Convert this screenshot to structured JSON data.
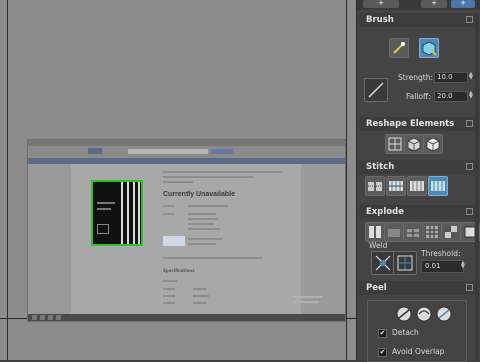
{
  "panel": {
    "brush": {
      "title": "Brush",
      "strength_label": "Strength:",
      "strength_value": "10.0",
      "falloff_label": "Falloff:",
      "falloff_value": "20.0"
    },
    "reshape": {
      "title": "Reshape Elements"
    },
    "stitch": {
      "title": "Stitch"
    },
    "explode": {
      "title": "Explode",
      "weld_label": "Weld",
      "threshold_label": "Threshold:",
      "threshold_value": "0.01"
    },
    "peel": {
      "title": "Peel",
      "detach_label": "Detach",
      "detach_checked": true,
      "avoid_overlap_label": "Avoid Overlap",
      "avoid_overlap_checked": true
    },
    "top_buttons": [
      "+",
      "+",
      "+"
    ]
  },
  "viewport": {
    "page_heading": "Currently Unavailable",
    "specs_heading": "Specifications"
  },
  "colors": {
    "active_icon": "#4e88b4",
    "selection": "#2fc22f",
    "panel_bg": "#444444"
  }
}
